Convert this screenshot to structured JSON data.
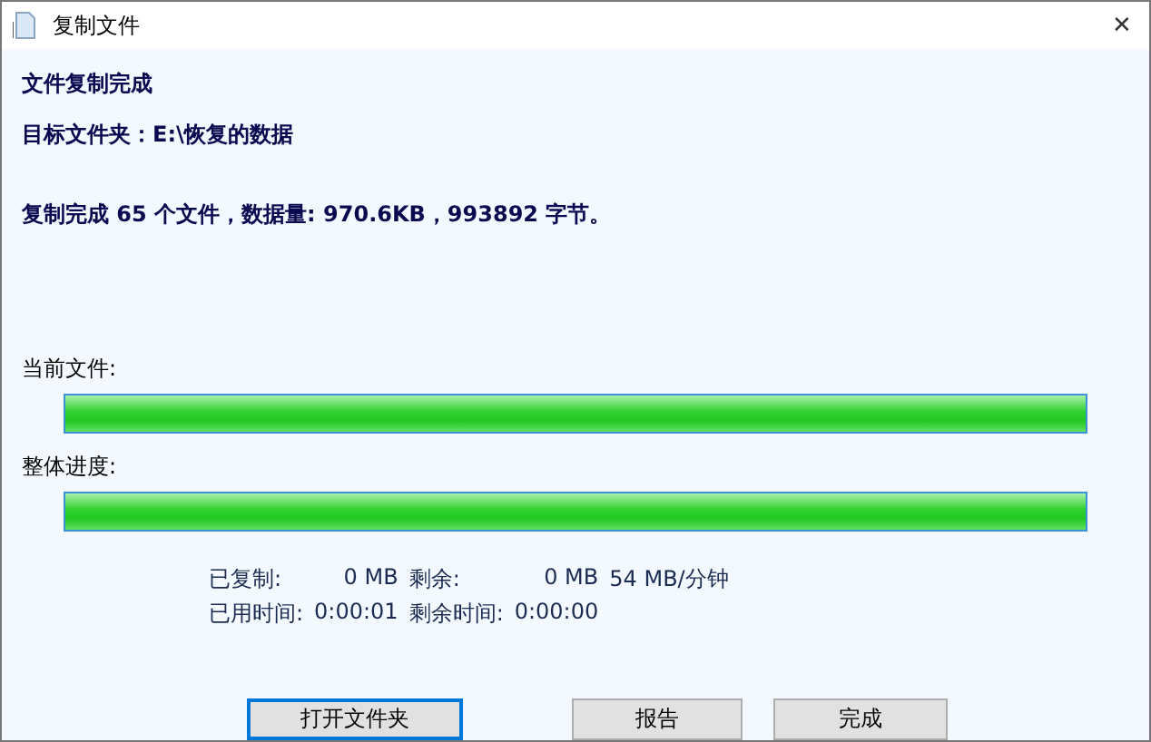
{
  "window": {
    "title": "复制文件",
    "close": "✕"
  },
  "heading": "文件复制完成",
  "target": "目标文件夹：E:\\恢复的数据",
  "summary": "复制完成 65 个文件，数据量: 970.6KB，993892 字节。",
  "progress": [
    {
      "label": "当前文件:",
      "level": 1.0
    },
    {
      "label": "整体进度:",
      "level": 1.0
    }
  ],
  "stats": [
    [
      "已复制:",
      "0 MB",
      "剩余:",
      "0 MB",
      "54 MB/分钟"
    ],
    [
      "已用时间:",
      "0:00:01",
      "剩余时间:",
      "0:00:00"
    ]
  ],
  "buttons": [
    {
      "label": "打开文件夹",
      "focused": true
    },
    {
      "label": "报告",
      "focused": false
    },
    {
      "label": "完成",
      "focused": false
    }
  ]
}
